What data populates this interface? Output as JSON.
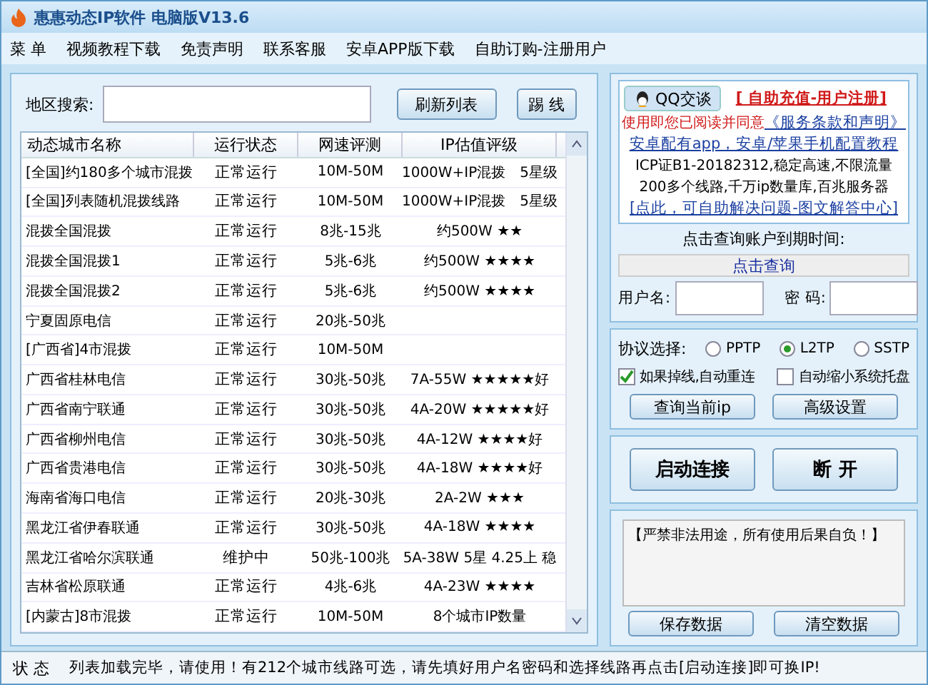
{
  "window": {
    "title": "惠惠动态IP软件 电脑版V13.6"
  },
  "menu": [
    "菜 单",
    "视频教程下载",
    "免责声明",
    "联系客服",
    "安卓APP版下载",
    "自助订购-注册用户"
  ],
  "search": {
    "label": "地区搜索:",
    "buttons": [
      "刷新列表",
      "踢 线"
    ]
  },
  "table": {
    "columns": [
      "动态城市名称",
      "运行状态",
      "网速评测",
      "IP估值评级"
    ],
    "rows": [
      {
        "cells": [
          "[全国]约180多个城市混拨",
          "正常运行",
          "10M-50M",
          "1000W+IP混拨　5星级"
        ]
      },
      {
        "cells": [
          "[全国]列表随机混拨线路",
          "正常运行",
          "10M-50M",
          "1000W+IP混拨　5星级"
        ]
      },
      {
        "cells": [
          "混拨全国混拨",
          "正常运行",
          "8兆-15兆",
          "约500W ★★"
        ]
      },
      {
        "cells": [
          "混拨全国混拨1",
          "正常运行",
          "5兆-6兆",
          "约500W ★★★★"
        ]
      },
      {
        "cells": [
          "混拨全国混拨2",
          "正常运行",
          "5兆-6兆",
          "约500W ★★★★"
        ]
      },
      {
        "cells": [
          "宁夏固原电信",
          "正常运行",
          "20兆-50兆"
        ]
      },
      {
        "cells": [
          "[广西省]4市混拨",
          "正常运行",
          "10M-50M"
        ]
      },
      {
        "cells": [
          "广西省桂林电信",
          "正常运行",
          "30兆-50兆",
          "7A-55W ★★★★★好"
        ]
      },
      {
        "cells": [
          "广西省南宁联通",
          "正常运行",
          "30兆-50兆",
          "4A-20W ★★★★★好"
        ]
      },
      {
        "cells": [
          "广西省柳州电信",
          "正常运行",
          "30兆-50兆",
          "4A-12W ★★★★好"
        ]
      },
      {
        "cells": [
          "广西省贵港电信",
          "正常运行",
          "30兆-50兆",
          "4A-18W ★★★★好"
        ]
      },
      {
        "cells": [
          "海南省海口电信",
          "正常运行",
          "20兆-30兆",
          "2A-2W ★★★"
        ]
      },
      {
        "cells": [
          "黑龙江省伊春联通",
          "正常运行",
          "30兆-50兆",
          "4A-18W ★★★★"
        ]
      },
      {
        "cells": [
          "黑龙江省哈尔滨联通",
          "维护中",
          "50兆-100兆",
          "5A-38W 5星 4.25上 稳"
        ]
      },
      {
        "cells": [
          "吉林省松原联通",
          "正常运行",
          "4兆-6兆",
          "4A-23W ★★★★"
        ]
      },
      {
        "cells": [
          "[内蒙古]8市混拨",
          "正常运行",
          "10M-50M",
          "8个城市IP数量"
        ]
      }
    ]
  },
  "info": {
    "qq_button": "QQ交谈",
    "register_link": "[ 自助充值-用户注册]",
    "agree_text": "使用即您已阅读并同意",
    "terms_link": "《服务条款和声明》",
    "app_link": "安卓配有app，安卓/苹果手机配置教程",
    "lines": [
      "ICP证B1-20182312,稳定高速,不限流量",
      "200多个线路,千万ip数量库,百兆服务器"
    ],
    "help_link": "[点此，可自助解决问题-图文解答中心]"
  },
  "account": {
    "expiry_label": "点击查询账户到期时间:",
    "query_button": "点击查询",
    "username_label": "用户名:",
    "password_label": "密 码:"
  },
  "protocol": {
    "label": "协议选择:",
    "options": [
      {
        "label": "PPTP",
        "selected": false
      },
      {
        "label": "L2TP",
        "selected": true
      },
      {
        "label": "SSTP",
        "selected": false
      }
    ],
    "checkboxes": [
      {
        "label": "如果掉线,自动重连",
        "checked": true
      },
      {
        "label": "自动缩小系统托盘",
        "checked": false
      }
    ],
    "buttons": [
      "查询当前ip",
      "高级设置"
    ]
  },
  "connect": {
    "buttons": [
      "启动连接",
      "断 开"
    ]
  },
  "log": {
    "text": "【严禁非法用途，所有使用后果自负！】",
    "buttons": [
      "保存数据",
      "清空数据"
    ]
  },
  "status_bar": {
    "label": "状 态",
    "text": "列表加载完毕，请使用！有212个城市线路可选，请先填好用户名密码和选择线路再点击[启动连接]即可换IP!"
  }
}
